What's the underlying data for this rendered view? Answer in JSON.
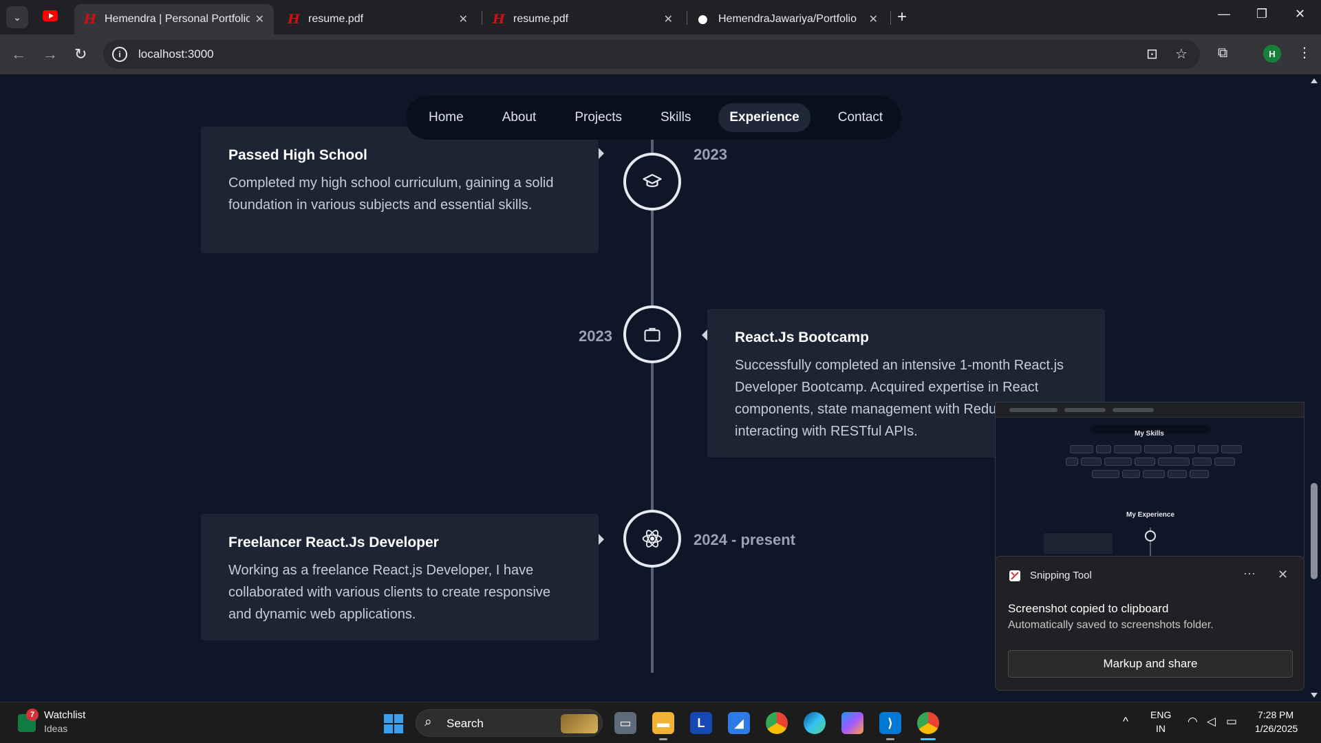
{
  "browser": {
    "tabs": [
      {
        "title": "Hemendra | Personal Portfolio",
        "favicon": "H"
      },
      {
        "title": "resume.pdf",
        "favicon": "H"
      },
      {
        "title": "resume.pdf",
        "favicon": "H"
      },
      {
        "title": "HemendraJawariya/Portfolio",
        "favicon": "github"
      }
    ],
    "url": "localhost:3000",
    "profile_initial": "H"
  },
  "nav": {
    "links": [
      "Home",
      "About",
      "Projects",
      "Skills",
      "Experience",
      "Contact"
    ],
    "active": "Experience"
  },
  "timeline": [
    {
      "title": "Passed High School",
      "description": "Completed my high school curriculum, gaining a solid foundation in various subjects and essential skills.",
      "date": "2023",
      "icon": "graduation-cap-icon",
      "side": "left"
    },
    {
      "title": "React.Js Bootcamp",
      "description": "Successfully completed an intensive 1-month React.js Developer Bootcamp. Acquired expertise in React components, state management with Redux, and interacting with RESTful APIs.",
      "date": "2023",
      "icon": "briefcase-icon",
      "side": "right"
    },
    {
      "title": "Freelancer React.Js Developer",
      "description": "Working as a freelance React.js Developer, I have collaborated with various clients to create responsive and dynamic web applications.",
      "date": "2024 - present",
      "icon": "react-icon",
      "side": "left"
    }
  ],
  "snip_preview": {
    "heading_skills": "My Skills",
    "heading_experience": "My Experience"
  },
  "toast": {
    "app": "Snipping Tool",
    "title": "Screenshot copied to clipboard",
    "subtitle": "Automatically saved to screenshots folder.",
    "button": "Markup and share",
    "more": "···",
    "close": "✕"
  },
  "taskbar": {
    "widget_title": "Watchlist",
    "widget_sub": "Ideas",
    "widget_badge": "7",
    "search_label": "Search",
    "lang_line1": "ENG",
    "lang_line2": "IN",
    "time": "7:28 PM",
    "date": "1/26/2025"
  },
  "colors": {
    "page_bg": "#0f1627",
    "card_bg": "#1d2535",
    "nav_bg": "#0a0f1c",
    "timeline_line": "#586072"
  }
}
